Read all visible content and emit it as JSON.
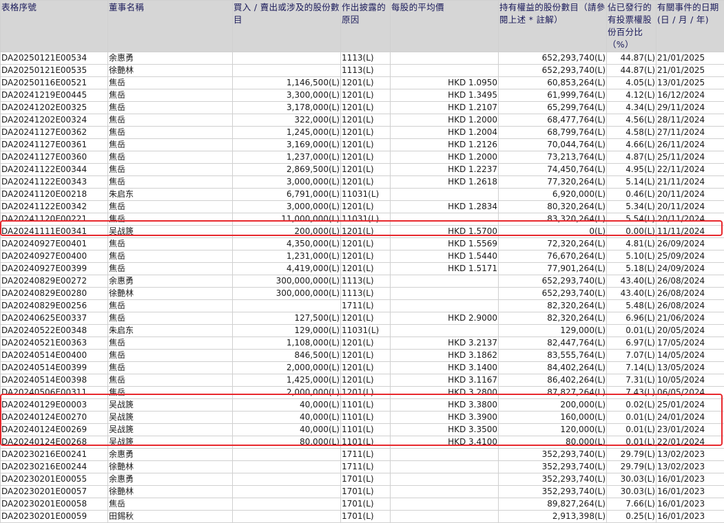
{
  "headers": [
    "表格序號",
    "董事名稱",
    "買入 / 賣出或涉及的股份數目",
    "作出披露的原因",
    "每股的平均價",
    "持有權益的股份數目（請參閱上述 * 註解）",
    "佔已發行的有投票權股份百分比（%）",
    "有關事件的日期 (日 / 月 / 年)"
  ],
  "rows": [
    {
      "id": "DA20250121E00534",
      "name": "余惠勇",
      "shares": "",
      "reason": "1113(L)",
      "price": "",
      "held": "652,293,740(L)",
      "pct": "44.87(L)",
      "date": "21/01/2025"
    },
    {
      "id": "DA20250121E00535",
      "name": "徐艷林",
      "shares": "",
      "reason": "1113(L)",
      "price": "",
      "held": "652,293,740(L)",
      "pct": "44.87(L)",
      "date": "21/01/2025"
    },
    {
      "id": "DA20250116E00521",
      "name": "焦岳",
      "shares": "1,146,500(L)",
      "reason": "1201(L)",
      "price": "HKD 1.0950",
      "held": "60,853,264(L)",
      "pct": "4.05(L)",
      "date": "13/01/2025"
    },
    {
      "id": "DA20241219E00445",
      "name": "焦岳",
      "shares": "3,300,000(L)",
      "reason": "1201(L)",
      "price": "HKD 1.3495",
      "held": "61,999,764(L)",
      "pct": "4.12(L)",
      "date": "16/12/2024"
    },
    {
      "id": "DA20241202E00325",
      "name": "焦岳",
      "shares": "3,178,000(L)",
      "reason": "1201(L)",
      "price": "HKD 1.2107",
      "held": "65,299,764(L)",
      "pct": "4.34(L)",
      "date": "29/11/2024"
    },
    {
      "id": "DA20241202E00324",
      "name": "焦岳",
      "shares": "322,000(L)",
      "reason": "1201(L)",
      "price": "HKD 1.2000",
      "held": "68,477,764(L)",
      "pct": "4.56(L)",
      "date": "28/11/2024"
    },
    {
      "id": "DA20241127E00362",
      "name": "焦岳",
      "shares": "1,245,000(L)",
      "reason": "1201(L)",
      "price": "HKD 1.2004",
      "held": "68,799,764(L)",
      "pct": "4.58(L)",
      "date": "27/11/2024"
    },
    {
      "id": "DA20241127E00361",
      "name": "焦岳",
      "shares": "3,169,000(L)",
      "reason": "1201(L)",
      "price": "HKD 1.2126",
      "held": "70,044,764(L)",
      "pct": "4.66(L)",
      "date": "26/11/2024"
    },
    {
      "id": "DA20241127E00360",
      "name": "焦岳",
      "shares": "1,237,000(L)",
      "reason": "1201(L)",
      "price": "HKD 1.2000",
      "held": "73,213,764(L)",
      "pct": "4.87(L)",
      "date": "25/11/2024"
    },
    {
      "id": "DA20241122E00344",
      "name": "焦岳",
      "shares": "2,869,500(L)",
      "reason": "1201(L)",
      "price": "HKD 1.2237",
      "held": "74,450,764(L)",
      "pct": "4.95(L)",
      "date": "22/11/2024"
    },
    {
      "id": "DA20241122E00343",
      "name": "焦岳",
      "shares": "3,000,000(L)",
      "reason": "1201(L)",
      "price": "HKD 1.2618",
      "held": "77,320,264(L)",
      "pct": "5.14(L)",
      "date": "21/11/2024"
    },
    {
      "id": "DA20241120E00218",
      "name": "朱启东",
      "shares": "6,791,000(L)",
      "reason": "11031(L)",
      "price": "",
      "held": "6,920,000(L)",
      "pct": "0.46(L)",
      "date": "20/11/2024"
    },
    {
      "id": "DA20241122E00342",
      "name": "焦岳",
      "shares": "3,000,000(L)",
      "reason": "1201(L)",
      "price": "HKD 1.2834",
      "held": "80,320,264(L)",
      "pct": "5.34(L)",
      "date": "20/11/2024"
    },
    {
      "id": "DA20241120E00221",
      "name": "焦岳",
      "shares": "11,000,000(L)",
      "reason": "11031(L)",
      "price": "",
      "held": "83,320,264(L)",
      "pct": "5.54(L)",
      "date": "20/11/2024"
    },
    {
      "id": "DA20241111E00341",
      "name": "吴战篪",
      "shares": "200,000(L)",
      "reason": "1201(L)",
      "price": "HKD 1.5700",
      "held": "0(L)",
      "pct": "0.00(L)",
      "date": "11/11/2024"
    },
    {
      "id": "DA20240927E00401",
      "name": "焦岳",
      "shares": "4,350,000(L)",
      "reason": "1201(L)",
      "price": "HKD 1.5569",
      "held": "72,320,264(L)",
      "pct": "4.81(L)",
      "date": "26/09/2024"
    },
    {
      "id": "DA20240927E00400",
      "name": "焦岳",
      "shares": "1,231,000(L)",
      "reason": "1201(L)",
      "price": "HKD 1.5440",
      "held": "76,670,264(L)",
      "pct": "5.10(L)",
      "date": "25/09/2024"
    },
    {
      "id": "DA20240927E00399",
      "name": "焦岳",
      "shares": "4,419,000(L)",
      "reason": "1201(L)",
      "price": "HKD 1.5171",
      "held": "77,901,264(L)",
      "pct": "5.18(L)",
      "date": "24/09/2024"
    },
    {
      "id": "DA20240829E00272",
      "name": "余惠勇",
      "shares": "300,000,000(L)",
      "reason": "1113(L)",
      "price": "",
      "held": "652,293,740(L)",
      "pct": "43.40(L)",
      "date": "26/08/2024"
    },
    {
      "id": "DA20240829E00280",
      "name": "徐艷林",
      "shares": "300,000,000(L)",
      "reason": "1113(L)",
      "price": "",
      "held": "652,293,740(L)",
      "pct": "43.40(L)",
      "date": "26/08/2024"
    },
    {
      "id": "DA20240829E00256",
      "name": "焦岳",
      "shares": "",
      "reason": "1711(L)",
      "price": "",
      "held": "82,320,264(L)",
      "pct": "5.48(L)",
      "date": "26/08/2024"
    },
    {
      "id": "DA20240625E00337",
      "name": "焦岳",
      "shares": "127,500(L)",
      "reason": "1201(L)",
      "price": "HKD 2.9000",
      "held": "82,320,264(L)",
      "pct": "6.96(L)",
      "date": "21/06/2024"
    },
    {
      "id": "DA20240522E00348",
      "name": "朱启东",
      "shares": "129,000(L)",
      "reason": "11031(L)",
      "price": "",
      "held": "129,000(L)",
      "pct": "0.01(L)",
      "date": "20/05/2024"
    },
    {
      "id": "DA20240521E00363",
      "name": "焦岳",
      "shares": "1,108,000(L)",
      "reason": "1201(L)",
      "price": "HKD 3.2137",
      "held": "82,447,764(L)",
      "pct": "6.97(L)",
      "date": "17/05/2024"
    },
    {
      "id": "DA20240514E00400",
      "name": "焦岳",
      "shares": "846,500(L)",
      "reason": "1201(L)",
      "price": "HKD 3.1862",
      "held": "83,555,764(L)",
      "pct": "7.07(L)",
      "date": "14/05/2024"
    },
    {
      "id": "DA20240514E00399",
      "name": "焦岳",
      "shares": "2,000,000(L)",
      "reason": "1201(L)",
      "price": "HKD 3.1400",
      "held": "84,402,264(L)",
      "pct": "7.14(L)",
      "date": "13/05/2024"
    },
    {
      "id": "DA20240514E00398",
      "name": "焦岳",
      "shares": "1,425,000(L)",
      "reason": "1201(L)",
      "price": "HKD 3.1167",
      "held": "86,402,264(L)",
      "pct": "7.31(L)",
      "date": "10/05/2024"
    },
    {
      "id": "DA20240506E00311",
      "name": "焦岳",
      "shares": "2,000,000(L)",
      "reason": "1201(L)",
      "price": "HKD 3.2800",
      "held": "87,827,264(L)",
      "pct": "7.43(L)",
      "date": "06/05/2024"
    },
    {
      "id": "DA20240129E00003",
      "name": "吴战篪",
      "shares": "40,000(L)",
      "reason": "1101(L)",
      "price": "HKD 3.3800",
      "held": "200,000(L)",
      "pct": "0.02(L)",
      "date": "25/01/2024"
    },
    {
      "id": "DA20240124E00270",
      "name": "吴战篪",
      "shares": "40,000(L)",
      "reason": "1101(L)",
      "price": "HKD 3.3900",
      "held": "160,000(L)",
      "pct": "0.01(L)",
      "date": "24/01/2024"
    },
    {
      "id": "DA20240124E00269",
      "name": "吴战篪",
      "shares": "40,000(L)",
      "reason": "1101(L)",
      "price": "HKD 3.3500",
      "held": "120,000(L)",
      "pct": "0.01(L)",
      "date": "23/01/2024"
    },
    {
      "id": "DA20240124E00268",
      "name": "吴战篪",
      "shares": "80,000(L)",
      "reason": "1101(L)",
      "price": "HKD 3.4100",
      "held": "80,000(L)",
      "pct": "0.01(L)",
      "date": "22/01/2024"
    },
    {
      "id": "DA20230216E00241",
      "name": "余惠勇",
      "shares": "",
      "reason": "1711(L)",
      "price": "",
      "held": "352,293,740(L)",
      "pct": "29.79(L)",
      "date": "13/02/2023"
    },
    {
      "id": "DA20230216E00244",
      "name": "徐艷林",
      "shares": "",
      "reason": "1711(L)",
      "price": "",
      "held": "352,293,740(L)",
      "pct": "29.79(L)",
      "date": "13/02/2023"
    },
    {
      "id": "DA20230201E00055",
      "name": "余惠勇",
      "shares": "",
      "reason": "1701(L)",
      "price": "",
      "held": "352,293,740(L)",
      "pct": "30.03(L)",
      "date": "16/01/2023"
    },
    {
      "id": "DA20230201E00057",
      "name": "徐艷林",
      "shares": "",
      "reason": "1701(L)",
      "price": "",
      "held": "352,293,740(L)",
      "pct": "30.03(L)",
      "date": "16/01/2023"
    },
    {
      "id": "DA20230201E00058",
      "name": "焦岳",
      "shares": "",
      "reason": "1701(L)",
      "price": "",
      "held": "89,827,264(L)",
      "pct": "7.66(L)",
      "date": "16/01/2023"
    },
    {
      "id": "DA20230201E00059",
      "name": "田錫秋",
      "shares": "",
      "reason": "1701(L)",
      "price": "",
      "held": "2,913,398(L)",
      "pct": "0.25(L)",
      "date": "16/01/2023"
    }
  ],
  "highlight_color": "#e8282d"
}
